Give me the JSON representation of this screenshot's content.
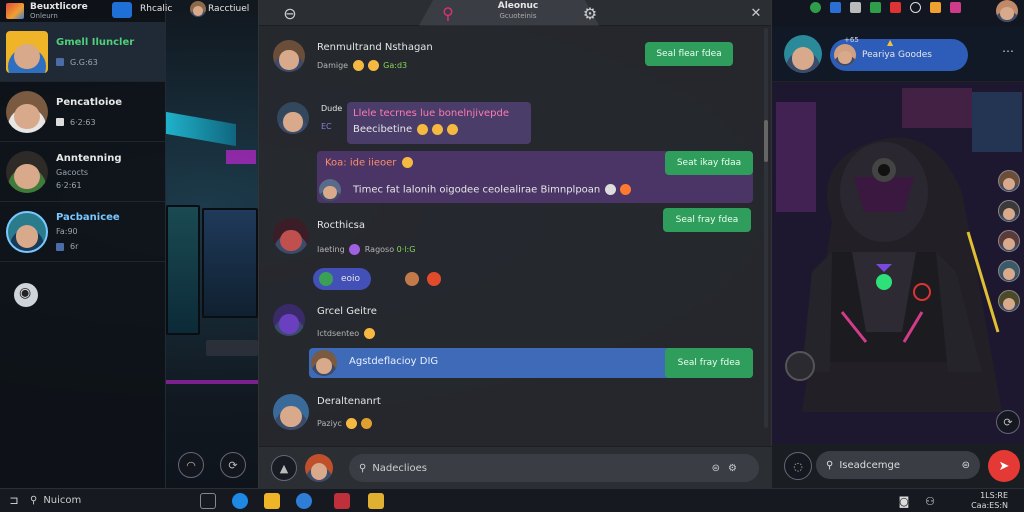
{
  "app": {
    "title": "Beuxtlicore",
    "subtitle": "Onleurn"
  },
  "topbar": {
    "channel_label": "Rhcalic",
    "user_label": "Racctiuel"
  },
  "contacts": [
    {
      "name": "Gmell Iluncler",
      "meta": "G.G:63"
    },
    {
      "name": "Pencatloioe",
      "meta": "6·2:63"
    },
    {
      "name": "Anntenning",
      "meta": "Gacocts",
      "meta2": "6·2:61"
    },
    {
      "name": "Pacbanicee",
      "meta": "Fa:90",
      "meta2": "6r"
    }
  ],
  "chat": {
    "header_title": "Aleonuc",
    "header_sub": "Gcuoteinis",
    "messages": [
      {
        "name": "Renmultrand Nsthagan",
        "sub": "Damige",
        "sub_accent": "Ga:d3",
        "pill": "Seal flear fdea"
      },
      {
        "name": "Dude",
        "sub": "EC",
        "bubble_line1": "Llele tecrnes lue bonelnjivepde",
        "bubble_line2": "Beecibetine"
      },
      {
        "name": "Koa: ide iieoer",
        "bubble_line": "Timec fat lalonih oigodee ceolealirae Bimnplpoan",
        "pill": "Seat ikay fdaa"
      },
      {
        "name": "Rocthicsa",
        "sub": "Iaeting",
        "sub2": "Ragoso",
        "sub3": "0·l:G",
        "chip": "eoio",
        "pill": "Seal fray fdea"
      },
      {
        "name": "Grcel Geitre",
        "sub": "Ictdsenteo",
        "bubble_line": "Agstdeflacioy DIG",
        "pill": "Seal fray fdea"
      },
      {
        "name": "Deraltenanrt",
        "sub": "Paziyc"
      }
    ],
    "composer_placeholder": "Nadeclioes"
  },
  "right": {
    "header_handle": "+65",
    "header_name": "Peariya Goodes",
    "composer_placeholder": "Iseadcemge"
  },
  "taskbar": {
    "search_placeholder": "Nuicom",
    "time": "1LS:RE",
    "date": "Caa:ES:N"
  }
}
